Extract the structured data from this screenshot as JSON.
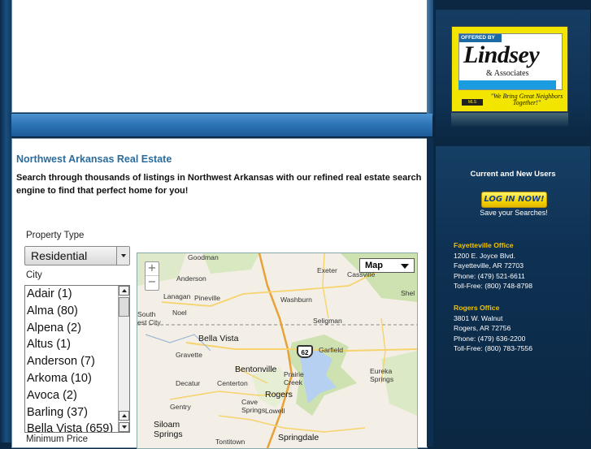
{
  "content": {
    "title": "Northwest Arkansas Real Estate",
    "intro": "Search through thousands of listings in Northwest Arkansas with our refined real estate search engine to find that perfect home for you!"
  },
  "search": {
    "property_type_label": "Property Type",
    "property_type_value": "Residential",
    "city_label": "City",
    "cities": [
      "Adair (1)",
      "Alma (80)",
      "Alpena (2)",
      "Altus (1)",
      "Anderson (7)",
      "Arkoma (10)",
      "Avoca (2)",
      "Barling (37)",
      "Bella Vista (659)"
    ],
    "min_price_label": "Minimum Price"
  },
  "map": {
    "type_label": "Map",
    "zoom_in": "+",
    "zoom_out": "−",
    "highway": "62",
    "towns": [
      "Goodman",
      "Anderson",
      "Exeter",
      "Cassville",
      "Shel",
      "Lanagan",
      "Pineville",
      "Washburn",
      "South",
      "est City",
      "Noel",
      "Seligman",
      "Bella Vista",
      "Gravette",
      "Garfield",
      "Decatur",
      "Centerton",
      "Bentonville",
      "Prairie",
      "Creek",
      "Eureka",
      "Springs",
      "Rogers",
      "Cave",
      "Springs",
      "Gentry",
      "Lowell",
      "Siloam",
      "Springs",
      "Tontitown",
      "Springdale"
    ],
    "colors": {
      "land": "#f3efe6",
      "forest": "#cde2b0",
      "water": "#b5d0f0",
      "road": "#f6d36c",
      "highway": "#e8a23a"
    }
  },
  "sidebar": {
    "logo": {
      "offered_by": "OFFERED BY",
      "name": "Lindsey",
      "assoc": "& Associates",
      "tagline": "\"We Bring Great Neighbors Together!\"",
      "badge": "MLS"
    },
    "users_heading": "Current and New Users",
    "login_label": "LOG IN NOW!",
    "save_text": "Save your Searches!",
    "offices": [
      {
        "name": "Fayetteville Office",
        "address": "1200 E. Joyce Blvd.",
        "city": "Fayetteville, AR 72703",
        "phone": "Phone: (479) 521-6611",
        "tollfree": "Toll-Free: (800) 748-8798"
      },
      {
        "name": "Rogers Office",
        "address": "3801 W. Walnut",
        "city": "Rogers, AR 72756",
        "phone": "Phone: (479) 636-2200",
        "tollfree": "Toll-Free: (800) 783-7556"
      }
    ],
    "colors": {
      "bg": "#0b2742",
      "office_name": "#f2c200",
      "button": "#f5d800"
    }
  }
}
